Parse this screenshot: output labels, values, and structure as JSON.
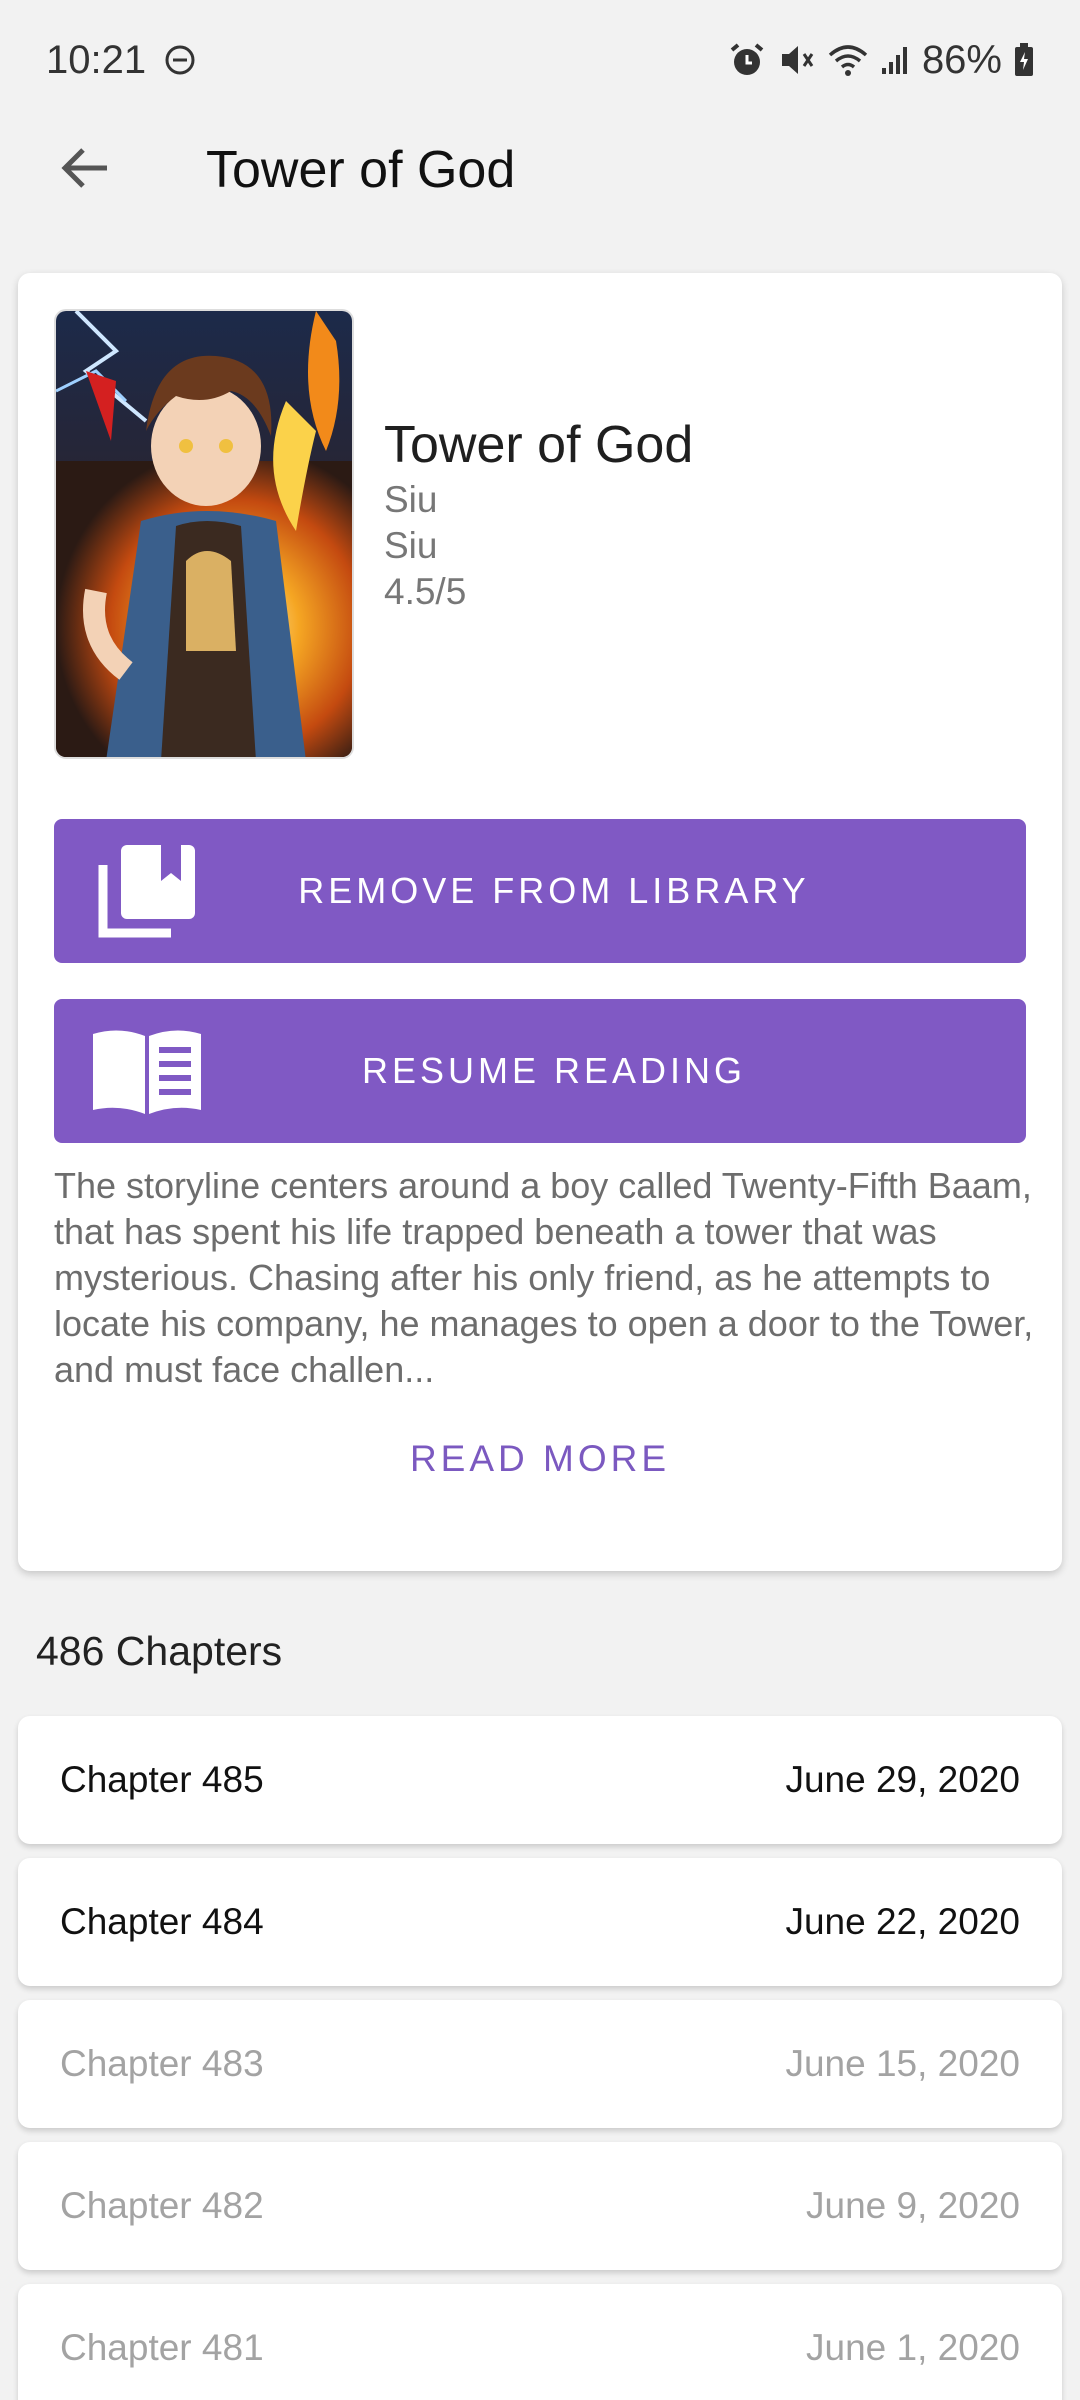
{
  "status_bar": {
    "time": "10:21",
    "battery": "86%"
  },
  "app_bar": {
    "title": "Tower of God"
  },
  "manga": {
    "title": "Tower of God",
    "author": "Siu",
    "artist": "Siu",
    "rating": "4.5/5",
    "description": "The storyline centers around a boy called Twenty-Fifth Baam, that has spent his life trapped beneath a tower that was mysterious. Chasing after his only friend, as he attempts to locate his company, he manages to open a door to the Tower, and must face challen..."
  },
  "buttons": {
    "library": "REMOVE FROM LIBRARY",
    "resume": "RESUME READING",
    "read_more": "READ MORE"
  },
  "chapters": {
    "count_label": "486 Chapters",
    "items": [
      {
        "name": "Chapter 485",
        "date": "June 29, 2020",
        "read": false
      },
      {
        "name": "Chapter 484",
        "date": "June 22, 2020",
        "read": false
      },
      {
        "name": "Chapter 483",
        "date": "June 15, 2020",
        "read": true
      },
      {
        "name": "Chapter 482",
        "date": "June 9, 2020",
        "read": true
      },
      {
        "name": "Chapter 481",
        "date": "June 1, 2020",
        "read": true
      }
    ]
  },
  "colors": {
    "accent": "#8059c4",
    "read_text": "#a3a3a3"
  }
}
